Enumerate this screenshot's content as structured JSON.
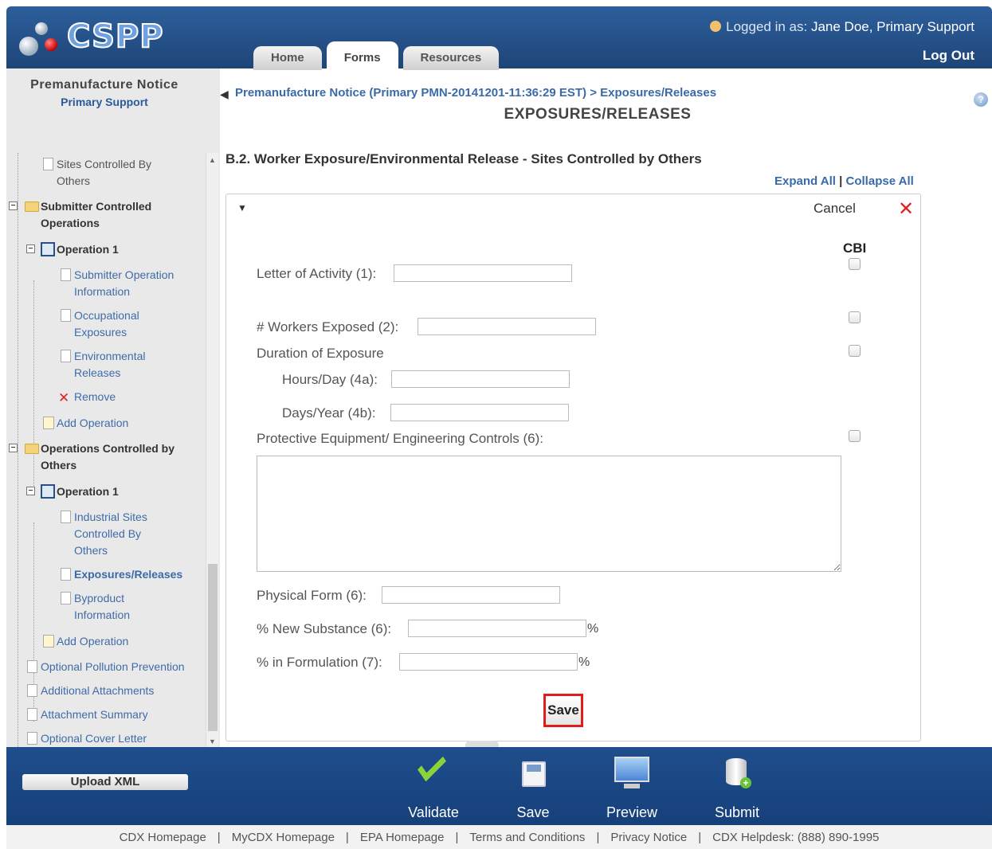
{
  "header": {
    "logo_text": "CSPP",
    "tabs": [
      {
        "label": "Home"
      },
      {
        "label": "Forms"
      },
      {
        "label": "Resources"
      }
    ],
    "logged_in_prefix": "Logged in as:",
    "logged_in_user": "Jane Doe, Primary Support",
    "logout_label": "Log Out"
  },
  "sidebar": {
    "title": "Premanufacture Notice",
    "subtitle": "Primary Support",
    "tree": {
      "sites_controlled_by_others": "Sites Controlled By Others",
      "submitter_controlled_operations": "Submitter Controlled Operations",
      "operation_1_a": "Operation 1",
      "submitter_operation_information": "Submitter Operation Information",
      "occupational_exposures": "Occupational Exposures",
      "environmental_releases": "Environmental Releases",
      "remove": "Remove",
      "add_operation_a": "Add Operation",
      "operations_controlled_by_others": "Operations Controlled by Others",
      "operation_1_b": "Operation 1",
      "industrial_sites_controlled_by_others": "Industrial Sites Controlled By Others",
      "exposures_releases": "Exposures/Releases",
      "byproduct_information": "Byproduct Information",
      "add_operation_b": "Add Operation",
      "optional_pollution_prevention": "Optional Pollution Prevention",
      "additional_attachments": "Additional Attachments",
      "attachment_summary": "Attachment Summary",
      "optional_cover_letter": "Optional Cover Letter"
    }
  },
  "main": {
    "breadcrumb": "Premanufacture Notice (Primary PMN-20141201-11:36:29 EST) > Exposures/Releases",
    "page_title": "EXPOSURES/RELEASES",
    "section_title": "B.2. Worker Exposure/Environmental Release - Sites Controlled by Others",
    "expand_all": "Expand All",
    "collapse_all": "Collapse All",
    "cancel_label": "Cancel",
    "cbi_label": "CBI",
    "fields": {
      "letter_of_activity": {
        "label": "Letter of Activity (1):",
        "value": ""
      },
      "workers_exposed": {
        "label": "# Workers Exposed (2):",
        "value": ""
      },
      "duration_of_exposure": {
        "label": "Duration of Exposure"
      },
      "hours_day": {
        "label": "Hours/Day (4a):",
        "value": ""
      },
      "days_year": {
        "label": "Days/Year (4b):",
        "value": ""
      },
      "protective_equipment": {
        "label": "Protective Equipment/ Engineering Controls (6):",
        "value": ""
      },
      "physical_form": {
        "label": "Physical Form (6):",
        "value": ""
      },
      "new_substance": {
        "label": "% New Substance (6):",
        "value": "",
        "suffix": "%"
      },
      "in_formulation": {
        "label": "% in Formulation (7):",
        "value": "",
        "suffix": "%"
      }
    },
    "save_label": "Save"
  },
  "footer": {
    "upload_xml": "Upload XML",
    "actions": [
      {
        "label": "Validate",
        "icon": "check-icon"
      },
      {
        "label": "Save",
        "icon": "disk-icon"
      },
      {
        "label": "Preview",
        "icon": "monitor-icon"
      },
      {
        "label": "Submit",
        "icon": "database-icon"
      }
    ],
    "links": [
      "CDX Homepage",
      "MyCDX Homepage",
      "EPA Homepage",
      "Terms and Conditions",
      "Privacy Notice",
      "CDX Helpdesk: (888) 890-1995"
    ],
    "separator": "|"
  }
}
